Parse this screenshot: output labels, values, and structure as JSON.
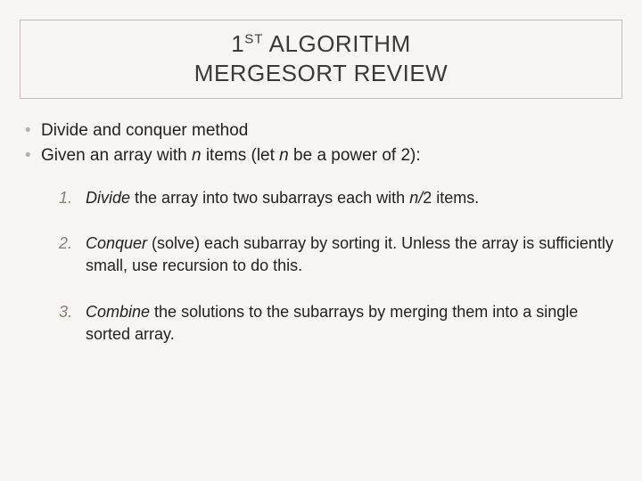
{
  "title": {
    "prefix_number": "1",
    "prefix_ordinal": "ST",
    "prefix_word": " ALGORITHM",
    "line2": "MERGESORT REVIEW"
  },
  "bullets": [
    {
      "text": "Divide and conquer method"
    },
    {
      "pre": "Given an array with ",
      "n1": "n",
      "mid": " items (let ",
      "n2": "n",
      "post": " be a power of 2):"
    }
  ],
  "steps": [
    {
      "lead": "Divide",
      "t1": " the array into two subarrays each with ",
      "n": "n/",
      "t2": "2 items."
    },
    {
      "lead": "Conquer",
      "t1": " (solve) each subarray by sorting it.  Unless the array is sufficiently small, use recursion to do this."
    },
    {
      "lead": "Combine",
      "t1": " the solutions to the subarrays by merging them into a single sorted array."
    }
  ]
}
